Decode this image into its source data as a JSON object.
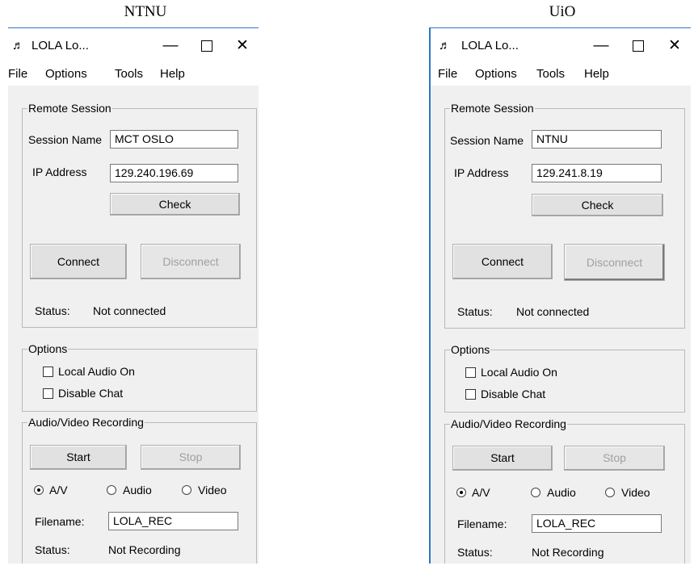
{
  "captions": {
    "left": "NTNU",
    "right": "UiO"
  },
  "left": {
    "title": "LOLA Lo...",
    "menu": [
      "File",
      "Options",
      "Tools",
      "Help"
    ],
    "remote": {
      "group_title": "Remote Session",
      "session_label": "Session Name",
      "session_value": "MCT OSLO",
      "ip_label": "IP Address",
      "ip_value": "129.240.196.69",
      "check": "Check",
      "connect": "Connect",
      "disconnect": "Disconnect",
      "status_label": "Status:",
      "status_value": "Not connected"
    },
    "options": {
      "group_title": "Options",
      "local_audio": "Local Audio On",
      "disable_chat": "Disable Chat"
    },
    "recording": {
      "group_title": "Audio/Video Recording",
      "start": "Start",
      "stop": "Stop",
      "radio_av": "A/V",
      "radio_audio": "Audio",
      "radio_video": "Video",
      "filename_label": "Filename:",
      "filename_value": "LOLA_REC",
      "status_label": "Status:",
      "status_value": "Not Recording"
    }
  },
  "right": {
    "title": "LOLA Lo...",
    "menu": [
      "File",
      "Options",
      "Tools",
      "Help"
    ],
    "remote": {
      "group_title": "Remote Session",
      "session_label": "Session Name",
      "session_value": "NTNU",
      "ip_label": "IP Address",
      "ip_value": "129.241.8.19",
      "check": "Check",
      "connect": "Connect",
      "disconnect": "Disconnect",
      "status_label": "Status:",
      "status_value": "Not connected"
    },
    "options": {
      "group_title": "Options",
      "local_audio": "Local Audio On",
      "disable_chat": "Disable Chat"
    },
    "recording": {
      "group_title": "Audio/Video Recording",
      "start": "Start",
      "stop": "Stop",
      "radio_av": "A/V",
      "radio_audio": "Audio",
      "radio_video": "Video",
      "filename_label": "Filename:",
      "filename_value": "LOLA_REC",
      "status_label": "Status:",
      "status_value": "Not Recording"
    }
  },
  "icons": {
    "app": "music-note-icon",
    "minimize": "minimize-icon",
    "maximize": "maximize-icon",
    "close": "close-icon"
  },
  "colors": {
    "window_border": "#2b78c4",
    "disabled_text": "#a0a0a0"
  }
}
